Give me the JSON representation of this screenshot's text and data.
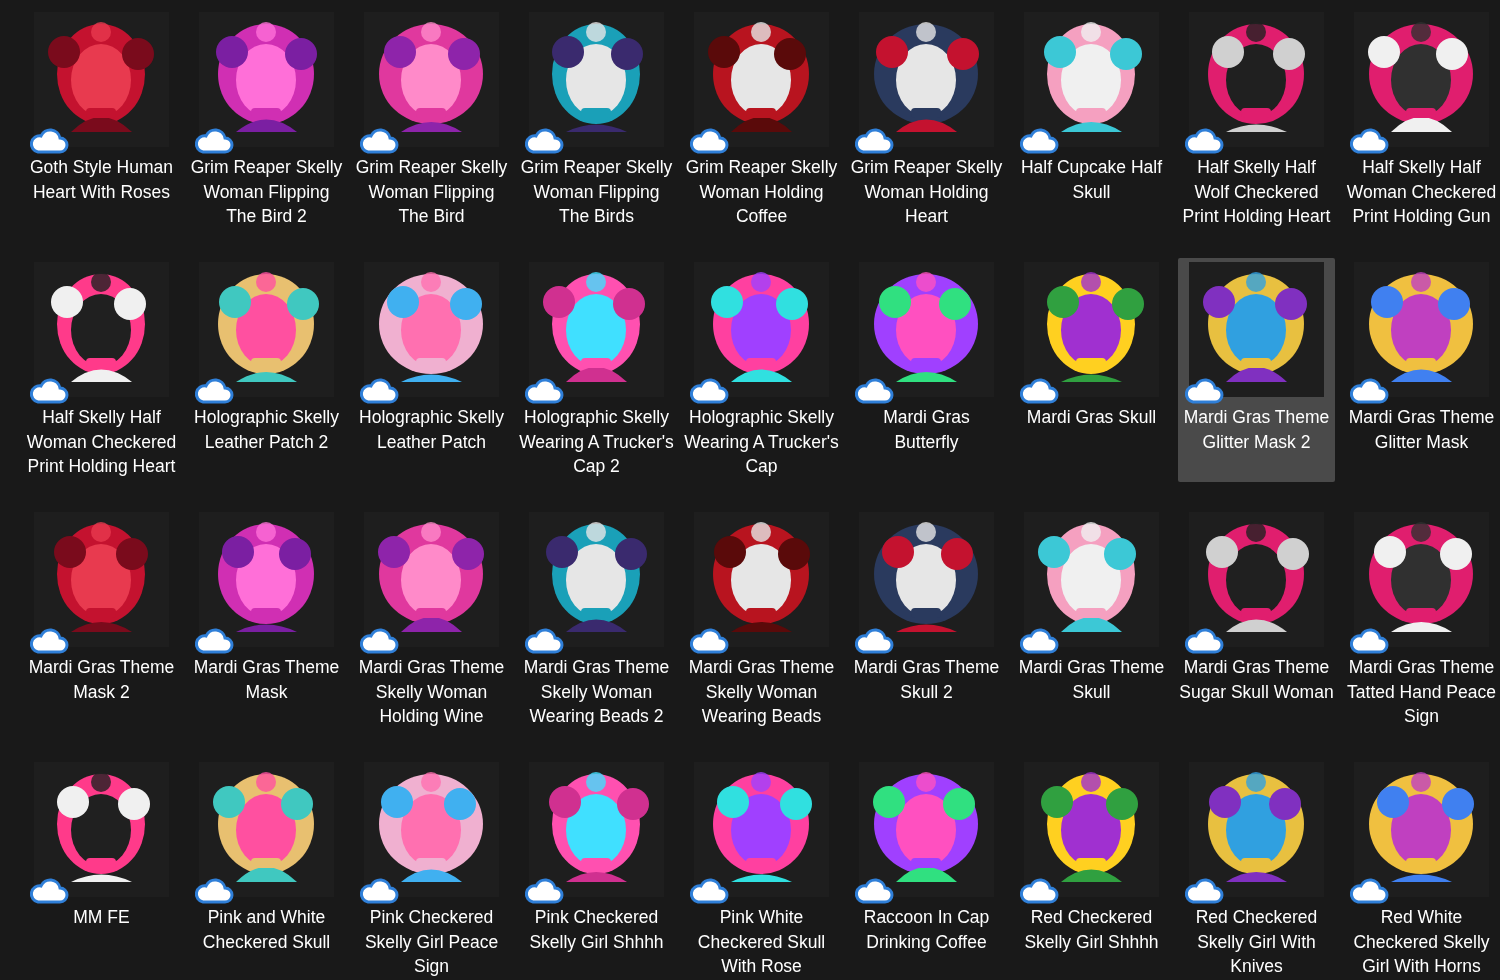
{
  "items": [
    {
      "label": "Goth Style Human Heart With Roses",
      "selected": false
    },
    {
      "label": "Grim Reaper Skelly Woman Flipping The Bird 2",
      "selected": false
    },
    {
      "label": "Grim Reaper Skelly Woman Flipping The Bird",
      "selected": false
    },
    {
      "label": "Grim Reaper Skelly Woman Flipping The Birds",
      "selected": false
    },
    {
      "label": "Grim Reaper Skelly Woman Holding Coffee",
      "selected": false
    },
    {
      "label": "Grim Reaper Skelly Woman Holding Heart",
      "selected": false
    },
    {
      "label": "Half Cupcake Half Skull",
      "selected": false
    },
    {
      "label": "Half Skelly Half Wolf Checkered Print Holding Heart",
      "selected": false
    },
    {
      "label": "Half Skelly Half Woman Checkered Print Holding Gun",
      "selected": false
    },
    {
      "label": "Half Skelly Half Woman Checkered Print Holding Heart",
      "selected": false
    },
    {
      "label": "Holographic Skelly Leather Patch 2",
      "selected": false
    },
    {
      "label": "Holographic Skelly Leather Patch",
      "selected": false
    },
    {
      "label": "Holographic Skelly Wearing A Trucker's Cap 2",
      "selected": false
    },
    {
      "label": "Holographic Skelly Wearing A Trucker's Cap",
      "selected": false
    },
    {
      "label": "Mardi Gras Butterfly",
      "selected": false
    },
    {
      "label": "Mardi Gras Skull",
      "selected": false
    },
    {
      "label": "Mardi Gras Theme Glitter Mask 2",
      "selected": true
    },
    {
      "label": "Mardi Gras Theme Glitter Mask",
      "selected": false
    },
    {
      "label": "Mardi Gras Theme Mask 2",
      "selected": false
    },
    {
      "label": "Mardi Gras Theme Mask",
      "selected": false
    },
    {
      "label": "Mardi Gras Theme Skelly Woman Holding Wine",
      "selected": false
    },
    {
      "label": "Mardi Gras Theme Skelly Woman Wearing Beads 2",
      "selected": false
    },
    {
      "label": "Mardi Gras Theme Skelly Woman Wearing Beads",
      "selected": false
    },
    {
      "label": "Mardi Gras Theme Skull 2",
      "selected": false
    },
    {
      "label": "Mardi Gras Theme Skull",
      "selected": false
    },
    {
      "label": "Mardi Gras Theme Sugar Skull Woman",
      "selected": false
    },
    {
      "label": "Mardi Gras Theme Tatted Hand Peace Sign",
      "selected": false
    },
    {
      "label": "MM FE",
      "selected": false
    },
    {
      "label": "Pink and White Checkered Skull",
      "selected": false
    },
    {
      "label": "Pink Checkered Skelly Girl Peace Sign",
      "selected": false
    },
    {
      "label": "Pink Checkered Skelly Girl Shhhh",
      "selected": false
    },
    {
      "label": "Pink White Checkered Skull With Rose",
      "selected": false
    },
    {
      "label": "Raccoon In Cap Drinking Coffee",
      "selected": false
    },
    {
      "label": "Red Checkered Skelly Girl Shhhh",
      "selected": false
    },
    {
      "label": "Red Checkered Skelly Girl With Knives",
      "selected": false
    },
    {
      "label": "Red White Checkered Skelly Girl With Horns",
      "selected": false
    }
  ]
}
